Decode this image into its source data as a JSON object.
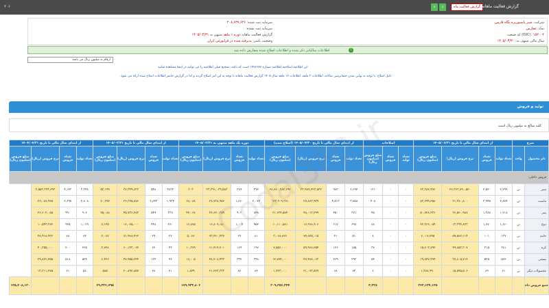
{
  "topbar": {
    "page_number": "۴۰۶",
    "title": "گزارش فعالیت ماهانه",
    "badge": "گزارش فعالیت ماه",
    "next_icon": "chevron-right-icon",
    "prev_icon": "chevron-left-icon"
  },
  "company": {
    "company_label": "شرکت:",
    "company_value": "شیر پاستوریزه پگاه فارس",
    "symbol_label": "نماد:",
    "symbol_value": "غفارس",
    "code_label": "کد صنعت (ISIC):",
    "code_value": "۱۵۲۰۰۴",
    "year_label": "سال مالی منتهی به:",
    "year_value": "۱۴۰۵/۰۴/۳۰",
    "reg_capital_label": "سرمایه ثبت شده:",
    "reg_capital_value": "۲۰۸,۶۳۷,۶۲۶",
    "unreg_capital_label": "سرمایه ثبت نشده:",
    "unreg_capital_value": "۰",
    "report_label": "گزارش فعالیت ماهانه",
    "period_label": "دوره ۱ ماهه",
    "period_end_label": "منتهی به",
    "period_end_value": "۱۴۰۵/۰۴/۳۱",
    "status_label": "وضعیت ناشر:",
    "status_value": "پذیرفته شده در فرابورس ایران"
  },
  "alert": {
    "text": "اطلاعات سالیانی ذکر شده و اطلاعات اصلاح شده سفارش داده شد"
  },
  "unit_box": {
    "text": "ارقام به میلیون ریال می باشد"
  },
  "notes": {
    "note1": "این اطلاعیه اصلاحیه اطلاعیه شماره ۱۴۷۶۶۸۷ است که باعث تصحیح قبلی اطلاعیه را می توانید در اینجا مشاهده نمایید",
    "note2": "دلیل اصلاح: با توجه به نهایی شدن حسابرسی سالانه، اطلاعات ۳ ماهه، اطلاعات ۱۲ ماهه سال ۱۴۰۵ گزارش فعالیت ماهانه با توجه به این امر اصلاح گردید و لذا در گزارش حاضر اطلاعات اصلاح شده ارائه می شود."
  },
  "section": {
    "title": "تولید و فروش",
    "subnote": "کلیه مبالغ به میلیون ریال است"
  },
  "table": {
    "group_headers": [
      "شرح",
      "از ابتدای سال مالی تا تاریخ ۱۴۰۵/۰۶/۳۱",
      "اصلاحات",
      "از ابتدای سال مالی تا تاریخ ۱۴۰۵/۰۴/۳۰ (اصلاح شده)",
      "دوره یک ماهه منتهی به ۱۴۰۵/۰۲/۳۱",
      "از ابتدای سال مالی تا تاریخ ۱۴۰۵/۰۲/۳۱",
      "از ابتدای سال مالی تا تاریخ ۱۴۰۴/۰۴/۳۱"
    ],
    "col_headers": [
      "نام محصول",
      "واحد",
      "تعداد تولید",
      "تعداد فروش",
      "نرخ فروش (ریال)",
      "مبلغ فروش (میلیون ریال)",
      "تعداد تولید",
      "تعداد فروش",
      "مبلغ فروش (میلیون ریال)",
      "تعداد تولید",
      "تعداد فروش",
      "نرخ فروش (ریال)",
      "مبلغ فروش (میلیون ریال)",
      "تعداد تولید",
      "تعداد فروش",
      "نرخ فروش (ریال)",
      "مبلغ فروش (میلیون ریال)",
      "تعداد تولید",
      "تعداد فروش",
      "نرخ فروش (ریال)",
      "مبلغ فروش (میلیون ریال)",
      "تعداد تولید",
      "تعداد فروش",
      "نرخ فروش (ریال)",
      "مبلغ فروش (میلیون ریال)"
    ],
    "group_row": "فروش داخلی:",
    "rows": [
      [
        "شیر",
        "تن",
        "۲,۲۹۹",
        "۲,۵۲۰",
        "۲۶,۳۶۳,۸۹۰,۵۲۰",
        "۶۳,۳۸۲,۹۹۶",
        "۰",
        "۰",
        "۱۳۱",
        "۶,۶۹۴",
        "۹۸۳",
        "۳۳,۹۸۹,۲۲۳,۵۳۲",
        "۲۸,۷۷۰,۳۸۲,۲۹۲",
        "۳۷۲",
        "۳۸۹",
        "۳۳,۳۹۱,۰۳۹,۵۸۳",
        "۳۰۳",
        "۳۸۳۲",
        "۵۴۸",
        "۳۷,۳۴۹,۸۳۳",
        "۵۳,۱۹۹",
        "۳,۳۴۸",
        "۴,۱۲۳",
        "۳,۵۵۳,۳۳۴,۶۹۳"
      ],
      [
        "ماست",
        "تن",
        "۲,۸۸۴",
        "۳,۹۴۵",
        "۲۱,۳۸۰,۸۰۰",
        "۸۳,۶۹۹,۲۵۸",
        "۰",
        "۰",
        "۴۰۸",
        "۳,۷۵۸",
        "۴,۵۱۳",
        "۲۷,۸۶۳,۹۳۹",
        "۱۲۳,۹۰۹,۳۷۱",
        "۲,۰۷۲",
        "۱,۸۶۰",
        "۳۸,۷۳۸,۹۵۶",
        "۶۸,۰۸۸",
        "۱,۹۳۴",
        "۲,۸۴۳",
        "۳۶,۳۷۵,۸۷۶",
        "۷۰,۳۷۷",
        "۲,۸۰۸",
        "۲,۶۹۷",
        "۲۶,۰۸۷,۹۶۵"
      ],
      [
        "پنیر",
        "تن",
        "۱,۲۱۸",
        "۱,۳۸۷",
        "۳۶,۵۶۰,۹۸۷",
        "۵۰,۷۲۸,۲۳۶",
        "۰",
        "۰",
        "۴۵",
        "۳۷۱",
        "۴۵۰",
        "۴۸,۰۱۳,۲۹۹",
        "۲۱,۶۳۴,۵۷۴",
        "۸۴۸",
        "۹۰۳",
        "۴۶,۶۲۰,۳۵۹",
        "۴۲,۰۶۷",
        "۳۳۸",
        "۵۴۹",
        "۴۵,۷۳۶,۲۸۳",
        "۲۵,۰۸۸",
        "۹۰۶",
        "۹۹۰",
        "۲۶,۶۰۲,۰۸۵"
      ],
      [
        "دوغ",
        "تن",
        "۱,۶۶۰",
        "۱,۶۷۰",
        "۱۳,۳۹۴,۸۳۳",
        "۲۲,۳۶۶,۰۵۹",
        "۰",
        "۰",
        "۸۸",
        "۶۹۸",
        "۶۱۷",
        "۱۶,۳۸۸,۹۰۶",
        "۱۰,۱۱۰,۵۸۱",
        "۹۵۲",
        "۱,۰۰۴",
        "۱۶,۸۰۹,۱۸۰",
        "۱۶,۸۷۵",
        "۴۶۰",
        "۴۴۸",
        "۱۶,۰۷۵,۰۰۰",
        "۷,۱۲۵",
        "۱,۰۶۹",
        "۹۲۵",
        "۱۰,۵۴۳,۳۸۴"
      ],
      [
        "خامه",
        "تن",
        "۱۳۷",
        "۱۰۱",
        "۵۹,۵۸۲,۱۱۴",
        "۶,۰۱۷,۷۹۵",
        "۰",
        "۰",
        "۸",
        "۵۱",
        "۴۱",
        "۷۴,۸۲۵,۰۱۵",
        "۳,۰۶۸,۸۲۶",
        "۸۱",
        "۶۹",
        "۷۳,۴۶۰,۴۳۷",
        "۵,۰۶۸",
        "۲۲",
        "۲۹",
        "۷۱,۹۶۸,۴۶۲",
        "۲,۰۸۷",
        "۸۴",
        "۸۸",
        "۴۸,۹۱۸,۹۳۲"
      ],
      [
        "کره",
        "تن",
        "۳۸۱",
        "۳۱۵",
        "۴۹,۸۵۳,۳۰۷",
        "۱۵,۷۰۳,۷۹۲",
        "۰",
        "۰",
        "۳۷",
        "۱۵۵",
        "۱۲۶",
        "۵۹,۹۶۸,۲۵۴",
        "۷,۵۵۶,۰۰۰",
        "۱۹۷",
        "۱۶۹",
        "۶۱,۴۱۴,۲۰۱",
        "۱۰,۳۷۹",
        "۴۳",
        "۶۲",
        "۶۰,۱۳۳,۰۶۴",
        "۳,۷۲۸",
        "۲۲۵",
        "۲۰۰",
        "۴۰,۳۵۵,۰۰۰"
      ],
      [
        "بستنی",
        "تن",
        "۵۶۲",
        "۵۲۵",
        "۳۷,۸۰۵,۷۱۴",
        "۱۹,۸۴۷,۹۹۹",
        "۰",
        "۰",
        "۵۴",
        "۲۹۳",
        "۲۶۹",
        "۴۷,۴۸۷,۰۶۳",
        "۱۲,۷۷۴,۰۰۰",
        "۳۴۸",
        "۳۳۲",
        "۴۸,۲۰۸,۴۳۳",
        "۱۶,۰۰۵",
        "۹۶",
        "۱۳۴",
        "۴۷,۹۵۵,۲۲۴",
        "۶,۴۲۶",
        "۵۲۴",
        "۵۱۸",
        "۲۹,۸۲۶,۲۵۵"
      ],
      [
        "محصولات دیگر",
        "تن",
        "۶۱",
        "۸۹",
        "۱۵,۵۹۵,۵۰۶",
        "۱,۳۸۷,۹۹۰",
        "۰",
        "۰",
        "۶",
        "۷۴",
        "۶۸",
        "۲۱,۰۷۳,۵۲۹",
        "۱,۴۳۳,۰۰۰",
        "۸۴",
        "۸۷",
        "۲۱,۲۶۳,۳۳۳",
        "۱,۸۴۹",
        "۲۱",
        "۲۸",
        "۲۰,۸۹۲,۸۵۷",
        "۵۸۵",
        "۵۸",
        "۶۱",
        "۱۳,۳۱۱,۴۷۵"
      ]
    ],
    "total": [
      "جمع فروش داخلی",
      "",
      "",
      "",
      "",
      "۲۶۳,۱۳۴,۱۲۵",
      "",
      "",
      "۲,۳۲۸",
      "",
      "",
      "",
      "۲۰۹,۲۵۶,۳۴۴",
      "",
      "",
      "",
      "۱۷۹,۹۳۳,۸۰۶",
      "",
      "",
      "",
      "۶۹,۳۳۶,۷۹۵",
      "",
      "",
      "",
      "۱۲۵,۴۰۸,۱۲۰"
    ]
  },
  "watermark": "Codal360.ir"
}
